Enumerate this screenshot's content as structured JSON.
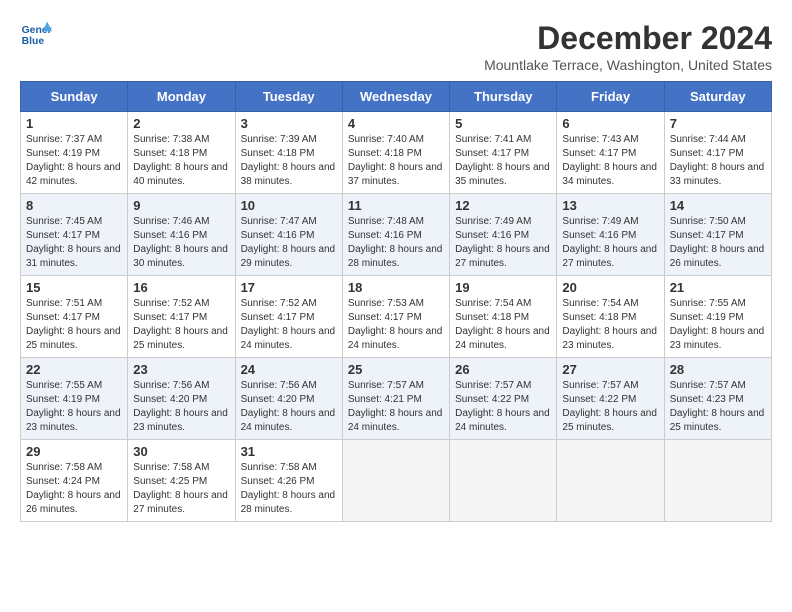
{
  "header": {
    "logo_line1": "General",
    "logo_line2": "Blue",
    "month_title": "December 2024",
    "location": "Mountlake Terrace, Washington, United States"
  },
  "columns": [
    "Sunday",
    "Monday",
    "Tuesday",
    "Wednesday",
    "Thursday",
    "Friday",
    "Saturday"
  ],
  "weeks": [
    [
      {
        "day": "1",
        "sunrise": "Sunrise: 7:37 AM",
        "sunset": "Sunset: 4:19 PM",
        "daylight": "Daylight: 8 hours and 42 minutes."
      },
      {
        "day": "2",
        "sunrise": "Sunrise: 7:38 AM",
        "sunset": "Sunset: 4:18 PM",
        "daylight": "Daylight: 8 hours and 40 minutes."
      },
      {
        "day": "3",
        "sunrise": "Sunrise: 7:39 AM",
        "sunset": "Sunset: 4:18 PM",
        "daylight": "Daylight: 8 hours and 38 minutes."
      },
      {
        "day": "4",
        "sunrise": "Sunrise: 7:40 AM",
        "sunset": "Sunset: 4:18 PM",
        "daylight": "Daylight: 8 hours and 37 minutes."
      },
      {
        "day": "5",
        "sunrise": "Sunrise: 7:41 AM",
        "sunset": "Sunset: 4:17 PM",
        "daylight": "Daylight: 8 hours and 35 minutes."
      },
      {
        "day": "6",
        "sunrise": "Sunrise: 7:43 AM",
        "sunset": "Sunset: 4:17 PM",
        "daylight": "Daylight: 8 hours and 34 minutes."
      },
      {
        "day": "7",
        "sunrise": "Sunrise: 7:44 AM",
        "sunset": "Sunset: 4:17 PM",
        "daylight": "Daylight: 8 hours and 33 minutes."
      }
    ],
    [
      {
        "day": "8",
        "sunrise": "Sunrise: 7:45 AM",
        "sunset": "Sunset: 4:17 PM",
        "daylight": "Daylight: 8 hours and 31 minutes."
      },
      {
        "day": "9",
        "sunrise": "Sunrise: 7:46 AM",
        "sunset": "Sunset: 4:16 PM",
        "daylight": "Daylight: 8 hours and 30 minutes."
      },
      {
        "day": "10",
        "sunrise": "Sunrise: 7:47 AM",
        "sunset": "Sunset: 4:16 PM",
        "daylight": "Daylight: 8 hours and 29 minutes."
      },
      {
        "day": "11",
        "sunrise": "Sunrise: 7:48 AM",
        "sunset": "Sunset: 4:16 PM",
        "daylight": "Daylight: 8 hours and 28 minutes."
      },
      {
        "day": "12",
        "sunrise": "Sunrise: 7:49 AM",
        "sunset": "Sunset: 4:16 PM",
        "daylight": "Daylight: 8 hours and 27 minutes."
      },
      {
        "day": "13",
        "sunrise": "Sunrise: 7:49 AM",
        "sunset": "Sunset: 4:16 PM",
        "daylight": "Daylight: 8 hours and 27 minutes."
      },
      {
        "day": "14",
        "sunrise": "Sunrise: 7:50 AM",
        "sunset": "Sunset: 4:17 PM",
        "daylight": "Daylight: 8 hours and 26 minutes."
      }
    ],
    [
      {
        "day": "15",
        "sunrise": "Sunrise: 7:51 AM",
        "sunset": "Sunset: 4:17 PM",
        "daylight": "Daylight: 8 hours and 25 minutes."
      },
      {
        "day": "16",
        "sunrise": "Sunrise: 7:52 AM",
        "sunset": "Sunset: 4:17 PM",
        "daylight": "Daylight: 8 hours and 25 minutes."
      },
      {
        "day": "17",
        "sunrise": "Sunrise: 7:52 AM",
        "sunset": "Sunset: 4:17 PM",
        "daylight": "Daylight: 8 hours and 24 minutes."
      },
      {
        "day": "18",
        "sunrise": "Sunrise: 7:53 AM",
        "sunset": "Sunset: 4:17 PM",
        "daylight": "Daylight: 8 hours and 24 minutes."
      },
      {
        "day": "19",
        "sunrise": "Sunrise: 7:54 AM",
        "sunset": "Sunset: 4:18 PM",
        "daylight": "Daylight: 8 hours and 24 minutes."
      },
      {
        "day": "20",
        "sunrise": "Sunrise: 7:54 AM",
        "sunset": "Sunset: 4:18 PM",
        "daylight": "Daylight: 8 hours and 23 minutes."
      },
      {
        "day": "21",
        "sunrise": "Sunrise: 7:55 AM",
        "sunset": "Sunset: 4:19 PM",
        "daylight": "Daylight: 8 hours and 23 minutes."
      }
    ],
    [
      {
        "day": "22",
        "sunrise": "Sunrise: 7:55 AM",
        "sunset": "Sunset: 4:19 PM",
        "daylight": "Daylight: 8 hours and 23 minutes."
      },
      {
        "day": "23",
        "sunrise": "Sunrise: 7:56 AM",
        "sunset": "Sunset: 4:20 PM",
        "daylight": "Daylight: 8 hours and 23 minutes."
      },
      {
        "day": "24",
        "sunrise": "Sunrise: 7:56 AM",
        "sunset": "Sunset: 4:20 PM",
        "daylight": "Daylight: 8 hours and 24 minutes."
      },
      {
        "day": "25",
        "sunrise": "Sunrise: 7:57 AM",
        "sunset": "Sunset: 4:21 PM",
        "daylight": "Daylight: 8 hours and 24 minutes."
      },
      {
        "day": "26",
        "sunrise": "Sunrise: 7:57 AM",
        "sunset": "Sunset: 4:22 PM",
        "daylight": "Daylight: 8 hours and 24 minutes."
      },
      {
        "day": "27",
        "sunrise": "Sunrise: 7:57 AM",
        "sunset": "Sunset: 4:22 PM",
        "daylight": "Daylight: 8 hours and 25 minutes."
      },
      {
        "day": "28",
        "sunrise": "Sunrise: 7:57 AM",
        "sunset": "Sunset: 4:23 PM",
        "daylight": "Daylight: 8 hours and 25 minutes."
      }
    ],
    [
      {
        "day": "29",
        "sunrise": "Sunrise: 7:58 AM",
        "sunset": "Sunset: 4:24 PM",
        "daylight": "Daylight: 8 hours and 26 minutes."
      },
      {
        "day": "30",
        "sunrise": "Sunrise: 7:58 AM",
        "sunset": "Sunset: 4:25 PM",
        "daylight": "Daylight: 8 hours and 27 minutes."
      },
      {
        "day": "31",
        "sunrise": "Sunrise: 7:58 AM",
        "sunset": "Sunset: 4:26 PM",
        "daylight": "Daylight: 8 hours and 28 minutes."
      },
      null,
      null,
      null,
      null
    ]
  ]
}
